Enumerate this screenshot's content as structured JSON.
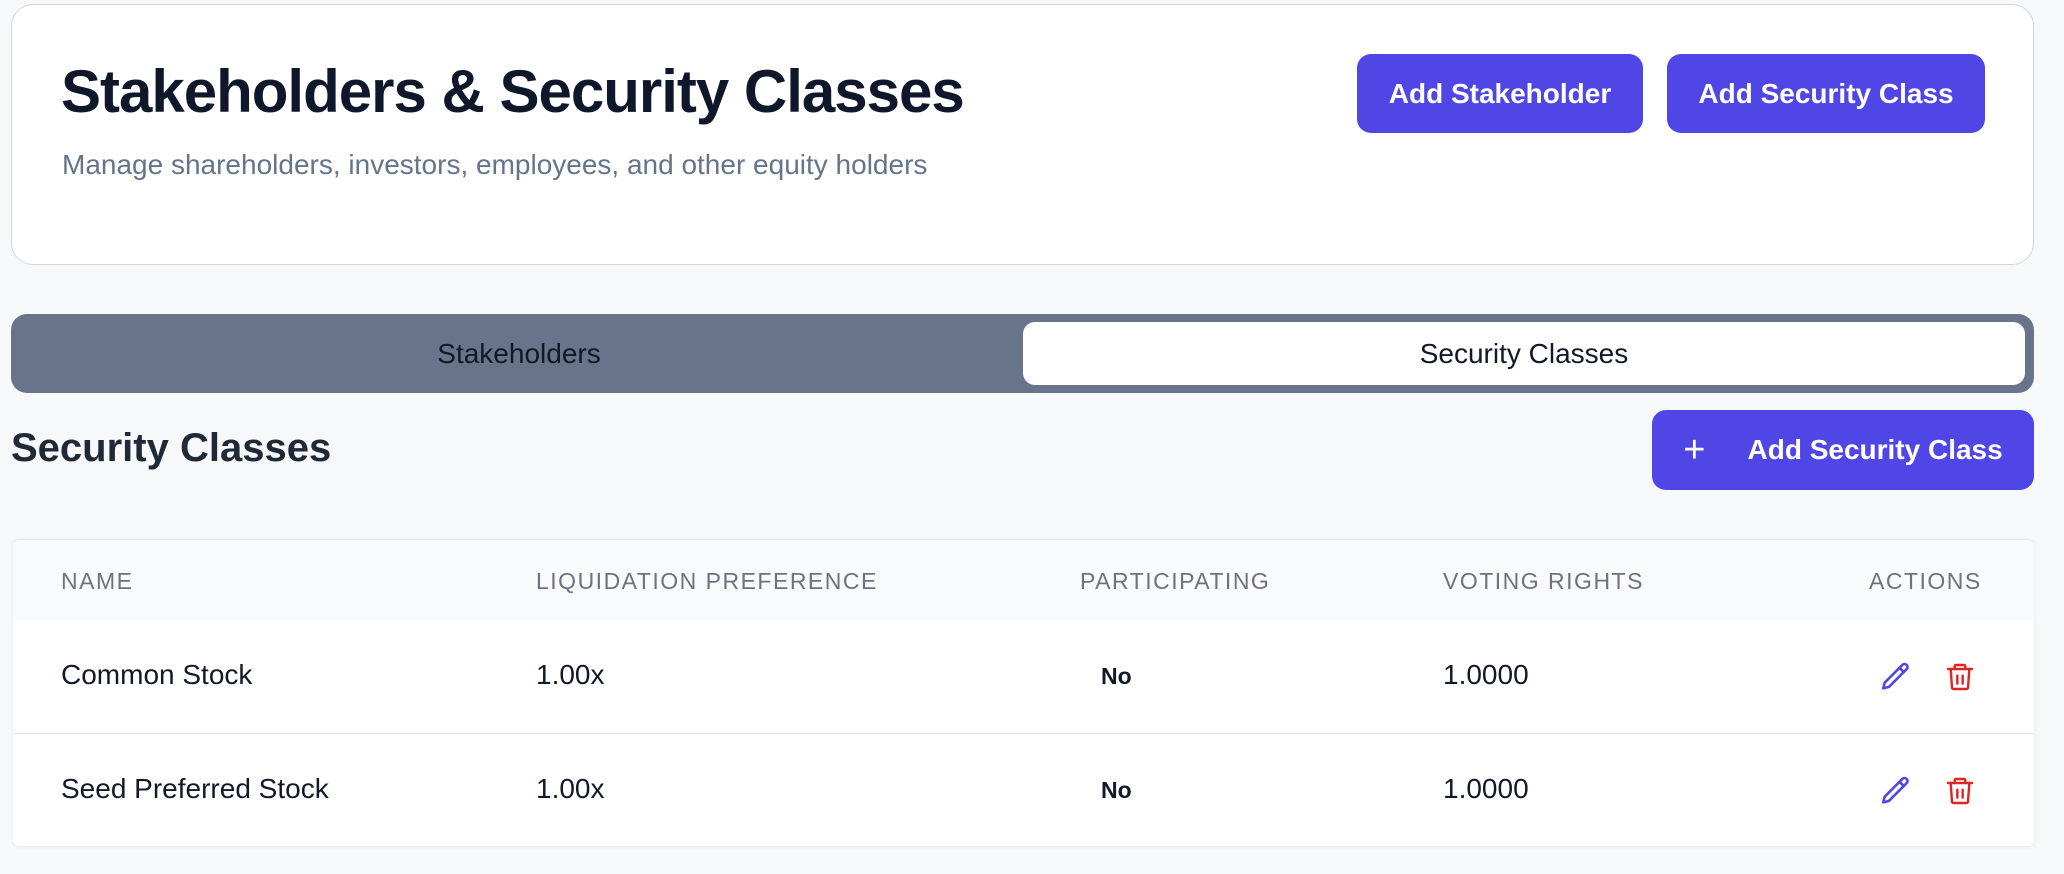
{
  "header": {
    "title": "Stakeholders & Security Classes",
    "subtitle": "Manage shareholders, investors, employees, and other equity holders",
    "add_stakeholder_label": "Add Stakeholder",
    "add_security_class_label": "Add Security Class"
  },
  "tabs": [
    {
      "label": "Stakeholders",
      "active": false
    },
    {
      "label": "Security Classes",
      "active": true
    }
  ],
  "section": {
    "title": "Security Classes",
    "add_button_label": "Add Security Class",
    "add_button_icon": "plus-icon"
  },
  "table": {
    "columns": [
      "NAME",
      "LIQUIDATION PREFERENCE",
      "PARTICIPATING",
      "VOTING RIGHTS",
      "ACTIONS"
    ],
    "rows": [
      {
        "name": "Common Stock",
        "liquidation_preference": "1.00x",
        "participating": "No",
        "voting_rights": "1.0000"
      },
      {
        "name": "Seed Preferred Stock",
        "liquidation_preference": "1.00x",
        "participating": "No",
        "voting_rights": "1.0000"
      }
    ]
  },
  "icons": {
    "edit": "pencil-icon",
    "delete": "trash-icon"
  },
  "colors": {
    "accent": "#4f46e5",
    "danger": "#dc2626",
    "tab_track": "#687489"
  }
}
